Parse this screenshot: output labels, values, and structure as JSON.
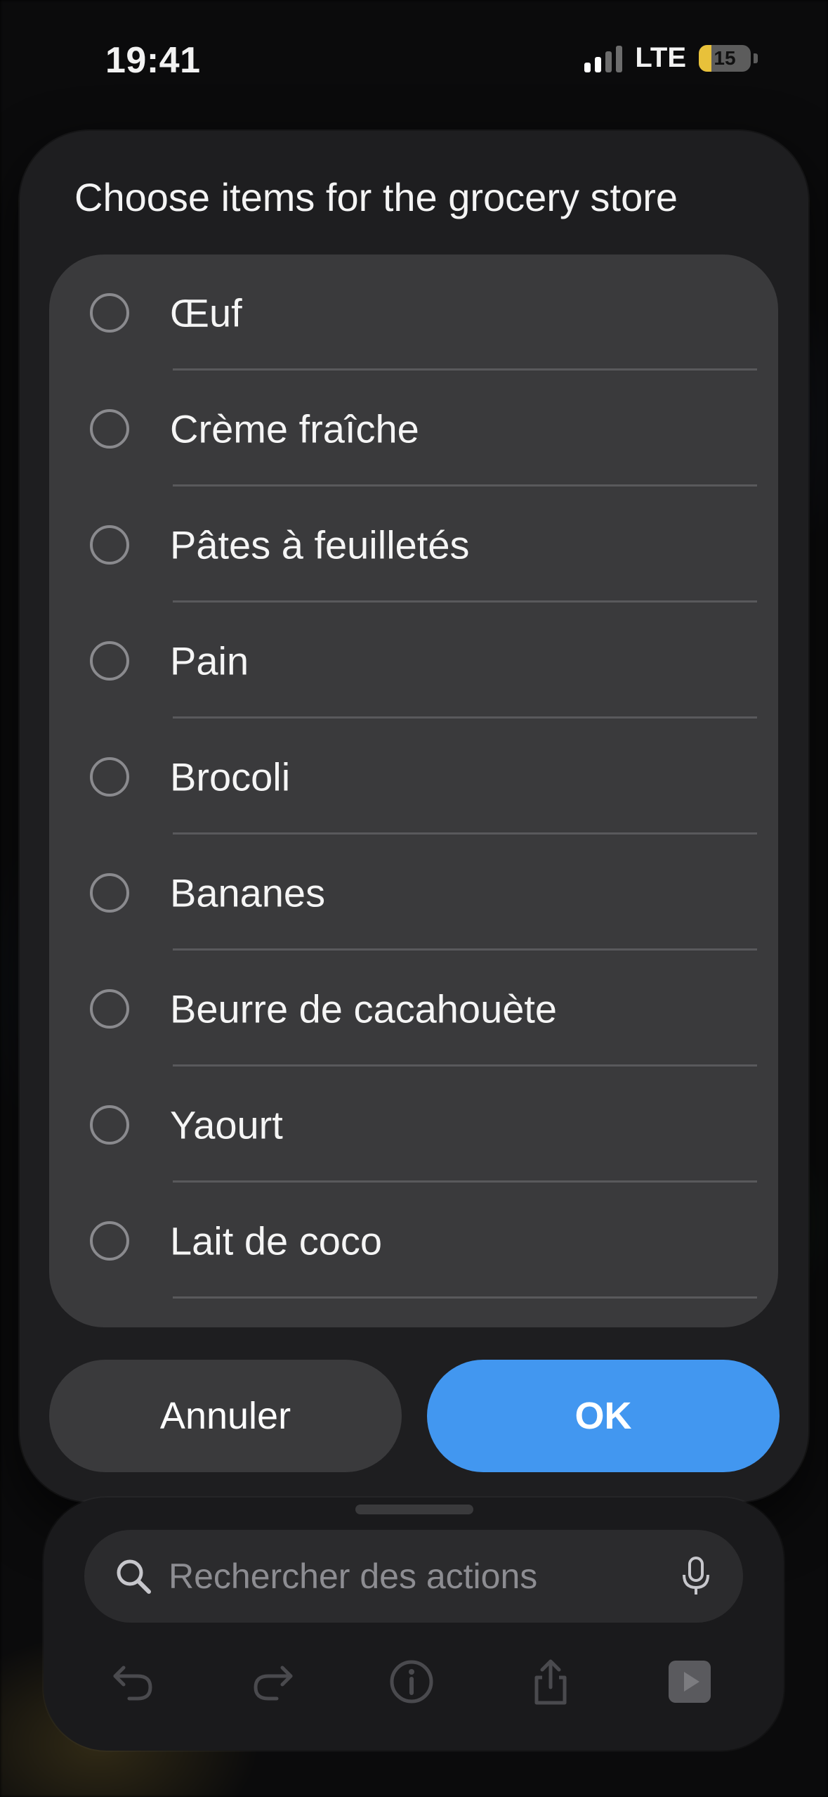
{
  "status_bar": {
    "time": "19:41",
    "network": "LTE",
    "battery_level": "15",
    "battery_color": "#e8c13a"
  },
  "dialog": {
    "title": "Choose items for the grocery store",
    "items": [
      {
        "label": "Œuf",
        "selected": false
      },
      {
        "label": "Crème fraîche",
        "selected": false
      },
      {
        "label": "Pâtes à feuilletés",
        "selected": false
      },
      {
        "label": "Pain",
        "selected": false
      },
      {
        "label": "Brocoli",
        "selected": false
      },
      {
        "label": "Bananes",
        "selected": false
      },
      {
        "label": "Beurre de cacahouète",
        "selected": false
      },
      {
        "label": "Yaourt",
        "selected": false
      },
      {
        "label": "Lait de coco",
        "selected": false
      }
    ],
    "cancel_label": "Annuler",
    "ok_label": "OK",
    "ok_color": "#4297f0"
  },
  "bottom_sheet": {
    "search_placeholder": "Rechercher des actions",
    "toolbar_icons": [
      "undo-icon",
      "redo-icon",
      "info-icon",
      "share-icon",
      "play-icon"
    ]
  }
}
